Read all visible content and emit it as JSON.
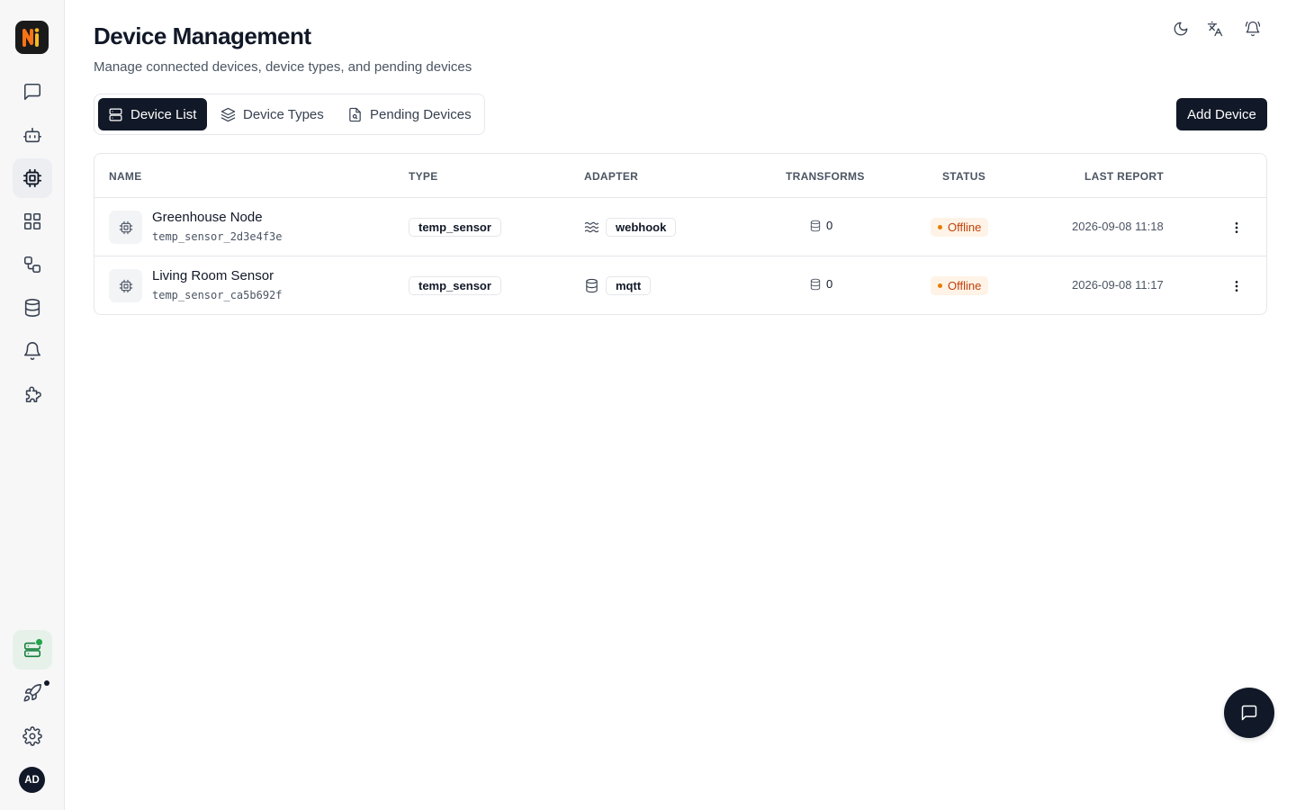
{
  "header": {
    "title": "Device Management",
    "subtitle": "Manage connected devices, device types, and pending devices"
  },
  "logo": {
    "name": "logo-icon",
    "colors": {
      "orange": "#f97316",
      "yellow": "#f5b921"
    }
  },
  "sidebar": {
    "items": [
      {
        "name": "chat",
        "icon": "message-square-icon"
      },
      {
        "name": "agents",
        "icon": "bot-icon"
      },
      {
        "name": "devices",
        "icon": "cpu-icon",
        "active": true
      },
      {
        "name": "dashboards",
        "icon": "layout-grid-icon"
      },
      {
        "name": "automations",
        "icon": "workflow-icon"
      },
      {
        "name": "data",
        "icon": "database-icon"
      },
      {
        "name": "alerts",
        "icon": "bell-icon"
      },
      {
        "name": "plugins",
        "icon": "puzzle-icon"
      }
    ],
    "bottom": [
      {
        "name": "gateway",
        "icon": "server-icon",
        "status": "online"
      },
      {
        "name": "updates",
        "icon": "rocket-icon"
      },
      {
        "name": "settings",
        "icon": "gear-icon"
      }
    ],
    "avatar_initials": "AD"
  },
  "top_actions": [
    "moon-icon",
    "translate-icon",
    "bell-ring-icon"
  ],
  "tabs": [
    {
      "label": "Device List",
      "icon": "server-icon",
      "active": true
    },
    {
      "label": "Device Types",
      "icon": "layers-icon"
    },
    {
      "label": "Pending Devices",
      "icon": "file-search-icon"
    }
  ],
  "add_button_label": "Add Device",
  "table": {
    "headers": {
      "name": "NAME",
      "type": "TYPE",
      "adapter": "ADAPTER",
      "transforms": "TRANSFORMS",
      "status": "STATUS",
      "last_report": "LAST REPORT"
    },
    "rows": [
      {
        "name": "Greenhouse Node",
        "id": "temp_sensor_2d3e4f3e",
        "type": "temp_sensor",
        "adapter": "webhook",
        "adapter_icon": "waves-icon",
        "transforms": "0",
        "status": "Offline",
        "last_report": "2026-09-08 11:18"
      },
      {
        "name": "Living Room Sensor",
        "id": "temp_sensor_ca5b692f",
        "type": "temp_sensor",
        "adapter": "mqtt",
        "adapter_icon": "database-icon",
        "transforms": "0",
        "status": "Offline",
        "last_report": "2026-09-08 11:17"
      }
    ]
  },
  "colors": {
    "primary": "#111827",
    "status_offline_bg": "#fef3e6",
    "status_offline_text": "#c2410c",
    "status_offline_dot": "#e67e00",
    "gateway_online": "#22a34a"
  }
}
